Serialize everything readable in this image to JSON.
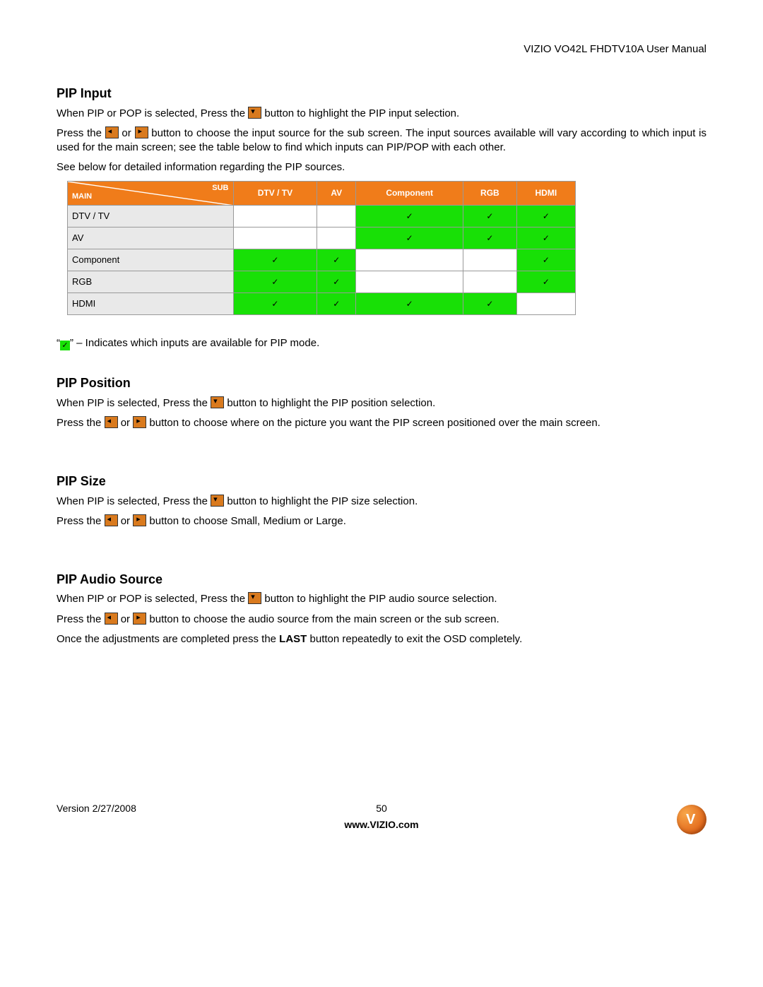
{
  "header": {
    "title": "VIZIO VO42L FHDTV10A User Manual"
  },
  "sections": {
    "pip_input": {
      "heading": "PIP Input",
      "p1a": "When PIP or POP is selected, Press the ",
      "p1b": " button to highlight the PIP input selection.",
      "p2a": "Press the ",
      "p2b": " or ",
      "p2c": " button to choose the input source for the sub screen. The input sources available will vary according to which input is used for the main screen; see the table below to find which inputs can PIP/POP with each other.",
      "p3": "See below for detailed information regarding the PIP sources."
    },
    "table": {
      "sub_label": "SUB",
      "main_label": "MAIN",
      "cols": [
        "DTV / TV",
        "AV",
        "Component",
        "RGB",
        "HDMI"
      ],
      "rows": [
        {
          "label": "DTV / TV",
          "cells": [
            false,
            false,
            true,
            true,
            true
          ]
        },
        {
          "label": "AV",
          "cells": [
            false,
            false,
            true,
            true,
            true
          ]
        },
        {
          "label": "Component",
          "cells": [
            true,
            true,
            false,
            false,
            true
          ]
        },
        {
          "label": "RGB",
          "cells": [
            true,
            true,
            false,
            false,
            true
          ]
        },
        {
          "label": "HDMI",
          "cells": [
            true,
            true,
            true,
            true,
            false
          ]
        }
      ]
    },
    "legend": {
      "a": "“",
      "b": "” – Indicates which inputs are available for PIP mode."
    },
    "pip_position": {
      "heading": "PIP Position",
      "p1a": "When PIP is selected, Press the ",
      "p1b": " button to highlight the PIP position selection.",
      "p2a": "Press the ",
      "p2b": " or ",
      "p2c": " button to choose where on the picture you want the PIP screen positioned over the main screen."
    },
    "pip_size": {
      "heading": "PIP Size",
      "p1a": "When PIP is selected, Press the ",
      "p1b": " button to highlight the PIP size selection.",
      "p2a": "Press the ",
      "p2b": " or ",
      "p2c": " button to choose Small, Medium or Large."
    },
    "pip_audio": {
      "heading": "PIP Audio Source",
      "p1a": "When PIP or POP is selected, Press the ",
      "p1b": " button to highlight the PIP audio source selection.",
      "p2a": "Press the ",
      "p2b": " or ",
      "p2c": " button to choose the audio source from the main screen or the sub screen.",
      "p3a": "Once the adjustments are completed press the ",
      "p3b": "LAST",
      "p3c": " button repeatedly to exit the OSD completely."
    }
  },
  "footer": {
    "version": "Version 2/27/2008",
    "page": "50",
    "url": "www.VIZIO.com"
  },
  "chart_data": {
    "type": "table",
    "title": "PIP/POP input compatibility matrix",
    "row_axis": "MAIN",
    "col_axis": "SUB",
    "columns": [
      "DTV / TV",
      "AV",
      "Component",
      "RGB",
      "HDMI"
    ],
    "rows": [
      "DTV / TV",
      "AV",
      "Component",
      "RGB",
      "HDMI"
    ],
    "values": [
      [
        0,
        0,
        1,
        1,
        1
      ],
      [
        0,
        0,
        1,
        1,
        1
      ],
      [
        1,
        1,
        0,
        0,
        1
      ],
      [
        1,
        1,
        0,
        0,
        1
      ],
      [
        1,
        1,
        1,
        1,
        0
      ]
    ],
    "legend": "✓ indicates inputs available for PIP mode"
  }
}
